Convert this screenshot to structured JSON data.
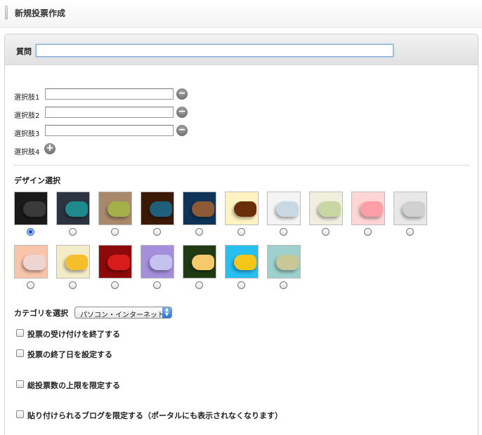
{
  "header": {
    "title": "新規投票作成"
  },
  "question": {
    "label": "質問",
    "value": ""
  },
  "choices": [
    {
      "label": "選択肢1",
      "value": "",
      "action": "remove"
    },
    {
      "label": "選択肢2",
      "value": "",
      "action": "remove"
    },
    {
      "label": "選択肢3",
      "value": "",
      "action": "remove"
    },
    {
      "label": "選択肢4",
      "action": "add"
    }
  ],
  "design": {
    "label": "デザイン選択",
    "selected_index": 0,
    "swatches": [
      {
        "bg": "#1a1a1a",
        "pill": "#3a3a3a"
      },
      {
        "bg": "#2b3440",
        "pill": "#1f8a8e"
      },
      {
        "bg": "#a8896b",
        "pill": "#a6b04a"
      },
      {
        "bg": "#3b1a05",
        "pill": "#1f5f7c"
      },
      {
        "bg": "#0f3458",
        "pill": "#8e5a36"
      },
      {
        "bg": "#fff3c4",
        "pill": "#6a2f0a"
      },
      {
        "bg": "#f4f4f4",
        "pill": "#c9d9e3"
      },
      {
        "bg": "#f0eedd",
        "pill": "#c8d6a2"
      },
      {
        "bg": "#ffd5d5",
        "pill": "#ff9ea6"
      },
      {
        "bg": "#e8e8e8",
        "pill": "#d0d0d0"
      },
      {
        "bg": "#f8c4aa",
        "pill": "#eed5d2"
      },
      {
        "bg": "#f2ecc8",
        "pill": "#f6bd2d"
      },
      {
        "bg": "#8e0a0a",
        "pill": "#d81b1b"
      },
      {
        "bg": "#a48fdd",
        "pill": "#c6c2f0"
      },
      {
        "bg": "#203a14",
        "pill": "#f6c96b"
      },
      {
        "bg": "#27bff0",
        "pill": "#f4c619"
      },
      {
        "bg": "#9ed0cd",
        "pill": "#c8c896"
      }
    ]
  },
  "category": {
    "label": "カテゴリを選択",
    "selected": "パソコン・インターネット"
  },
  "options": [
    {
      "label": "投票の受け付けを終了する"
    },
    {
      "label": "投票の終了日を設定する"
    },
    {
      "label": "総投票数の上限を限定する"
    },
    {
      "label": "貼り付けられるブログを限定する（ポータルにも表示されなくなります）"
    }
  ]
}
